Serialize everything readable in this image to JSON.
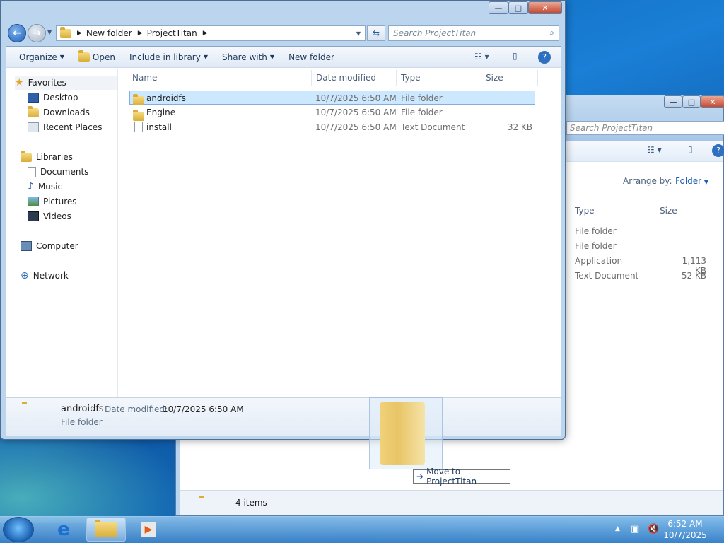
{
  "window": {
    "breadcrumb": [
      "New folder",
      "ProjectTitan"
    ],
    "search_placeholder": "Search ProjectTitan",
    "controls": {
      "minimize": "—",
      "maximize": "□",
      "close": "✕"
    }
  },
  "toolbar": {
    "organize": "Organize",
    "open": "Open",
    "include_in_library": "Include in library",
    "share_with": "Share with",
    "new_folder": "New folder"
  },
  "nav_pane": {
    "favorites": "Favorites",
    "favorites_items": [
      "Desktop",
      "Downloads",
      "Recent Places"
    ],
    "libraries": "Libraries",
    "libraries_items": [
      "Documents",
      "Music",
      "Pictures",
      "Videos"
    ],
    "computer": "Computer",
    "network": "Network"
  },
  "columns": {
    "name": "Name",
    "date": "Date modified",
    "type": "Type",
    "size": "Size"
  },
  "files": [
    {
      "name": "androidfs",
      "date": "10/7/2025 6:50 AM",
      "type": "File folder",
      "size": "",
      "icon": "folder-icon",
      "selected": true
    },
    {
      "name": "Engine",
      "date": "10/7/2025 6:50 AM",
      "type": "File folder",
      "size": "",
      "icon": "folder-icon",
      "selected": false
    },
    {
      "name": "install",
      "date": "10/7/2025 6:50 AM",
      "type": "Text Document",
      "size": "32 KB",
      "icon": "text-document-icon",
      "selected": false
    }
  ],
  "details_pane": {
    "name": "androidfs",
    "date_label": "Date modified:",
    "date_value": "10/7/2025 6:50 AM",
    "type": "File folder"
  },
  "back_window": {
    "search_placeholder": "Search ProjectTitan",
    "arrange_label": "Arrange by:",
    "arrange_value": "Folder",
    "columns": {
      "type": "Type",
      "size": "Size"
    },
    "rows": [
      {
        "type": "File folder",
        "size": ""
      },
      {
        "type": "File folder",
        "size": ""
      },
      {
        "type": "Application",
        "size": "1,113 KB"
      },
      {
        "type": "Text Document",
        "size": "52 KB"
      }
    ],
    "status_count": "4 items"
  },
  "drag": {
    "tooltip": "Move to ProjectTitan"
  },
  "taskbar": {
    "time": "6:52 AM",
    "date": "10/7/2025"
  }
}
